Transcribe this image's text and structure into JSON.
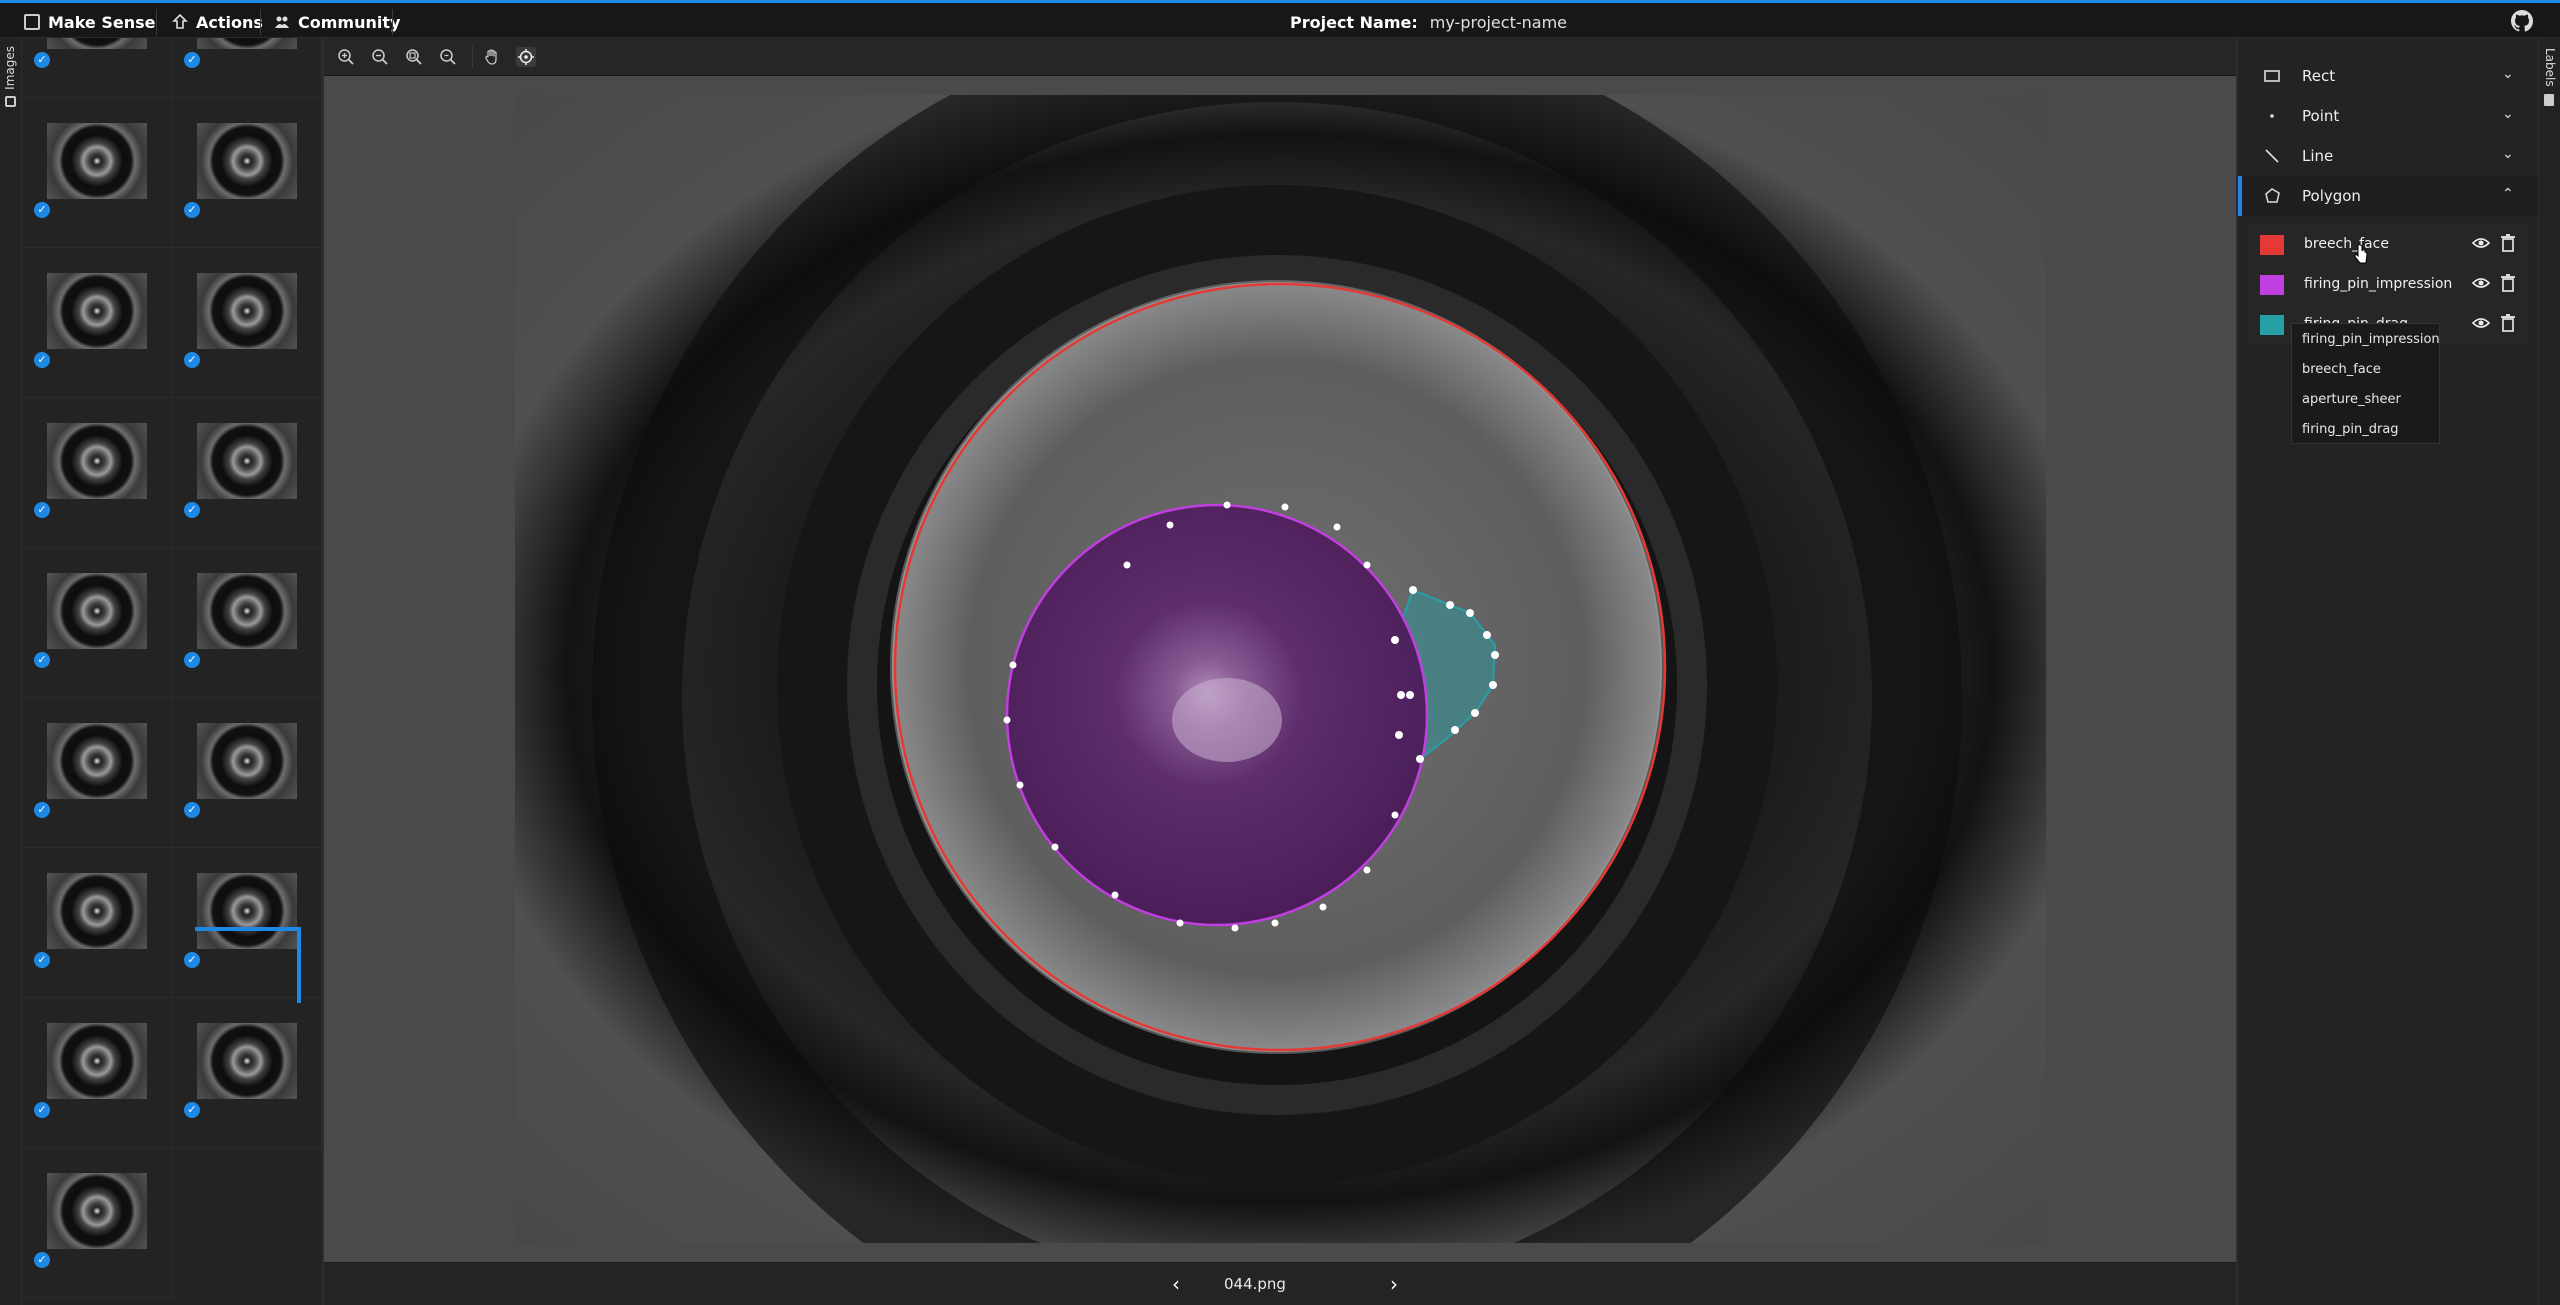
{
  "app": {
    "name": "Make Sense",
    "menu": [
      {
        "label": "Actions",
        "icon": "actions-icon"
      },
      {
        "label": "Community",
        "icon": "community-icon"
      }
    ],
    "project_label": "Project Name:",
    "project_name": "my-project-name",
    "github_icon": "github-icon"
  },
  "left_sidebar": {
    "tab_label": "Images",
    "thumbnail_count": 15,
    "checked_icon": "checkmark-icon",
    "selected_index": 13
  },
  "toolbar": {
    "tools": [
      "zoom-in-icon",
      "zoom-out-icon",
      "zoom-fit-icon",
      "zoom-max-icon",
      "pan-hand-icon",
      "crosshair-icon"
    ]
  },
  "bottom": {
    "filename": "044.png",
    "prev_icon": "chevron-left-icon",
    "next_icon": "chevron-right-icon"
  },
  "right_sidebar": {
    "tab_label": "Labels",
    "tools": [
      {
        "label": "Rect",
        "icon": "rect-icon",
        "expanded": false
      },
      {
        "label": "Point",
        "icon": "point-icon",
        "expanded": false
      },
      {
        "label": "Line",
        "icon": "line-icon",
        "expanded": false
      },
      {
        "label": "Polygon",
        "icon": "polygon-icon",
        "expanded": true
      }
    ],
    "labels": [
      {
        "name": "breech_face",
        "color": "#e53935"
      },
      {
        "name": "firing_pin_impression",
        "color": "#c13fe0"
      },
      {
        "name": "firing_pin_drag",
        "color": "#26a0a8"
      }
    ],
    "dropdown_options": [
      "firing_pin_impression",
      "breech_face",
      "aperture_sheer",
      "firing_pin_drag"
    ]
  },
  "colors": {
    "accent": "#1e88e5",
    "breech_face": "#e53935",
    "firing_pin_impression": "#c13fe0",
    "firing_pin_drag": "#26a0a8"
  }
}
